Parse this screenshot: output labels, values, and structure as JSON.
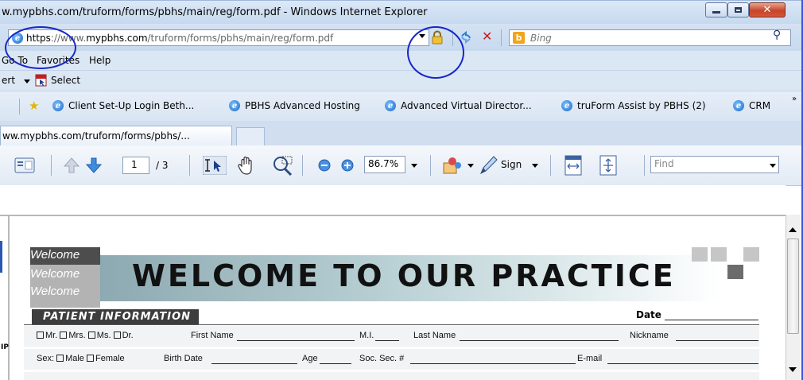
{
  "window": {
    "title": "w.mypbhs.com/truform/forms/pbhs/main/reg/form.pdf - Windows Internet Explorer"
  },
  "address": {
    "scheme": "https",
    "sep": "://",
    "prefix": "www.",
    "host": "mypbhs.com",
    "path": "/truform/forms/pbhs/main/reg/form.pdf",
    "search_placeholder": "Bing",
    "bing_logo": "b"
  },
  "menu": {
    "items": [
      "Go To",
      "Favorites",
      "Help"
    ]
  },
  "command_bar": {
    "convert_fragment": "ert",
    "select_label": "Select"
  },
  "favorites": {
    "items": [
      "Client Set-Up Login  Beth...",
      "PBHS Advanced Hosting",
      "Advanced Virtual Director...",
      "truForm Assist by PBHS (2)",
      "CRM"
    ],
    "overflow": "»"
  },
  "tab": {
    "title": "ww.mypbhs.com/truform/forms/pbhs/..."
  },
  "pdf_toolbar": {
    "page_current": "1",
    "page_total": "/ 3",
    "zoom": "86.7%",
    "sign_label": "Sign",
    "find_placeholder": "Find"
  },
  "document": {
    "welcome_tags": [
      "Welcome",
      "Welcome",
      "Welcome"
    ],
    "banner_title": "WELCOME TO OUR PRACTICE",
    "section_title": "PATIENT INFORMATION",
    "date_label": "Date",
    "left_margin_text": "IP",
    "row1": {
      "mr": "Mr.",
      "mrs": "Mrs.",
      "ms": "Ms.",
      "dr": "Dr.",
      "first_name": "First Name",
      "mi": "M.I.",
      "last_name": "Last Name",
      "nickname": "Nickname"
    },
    "row2": {
      "sex": "Sex:",
      "male": "Male",
      "female": "Female",
      "birth_date": "Birth Date",
      "age": "Age",
      "ssn": "Soc. Sec. #",
      "email": "E-mail"
    }
  }
}
